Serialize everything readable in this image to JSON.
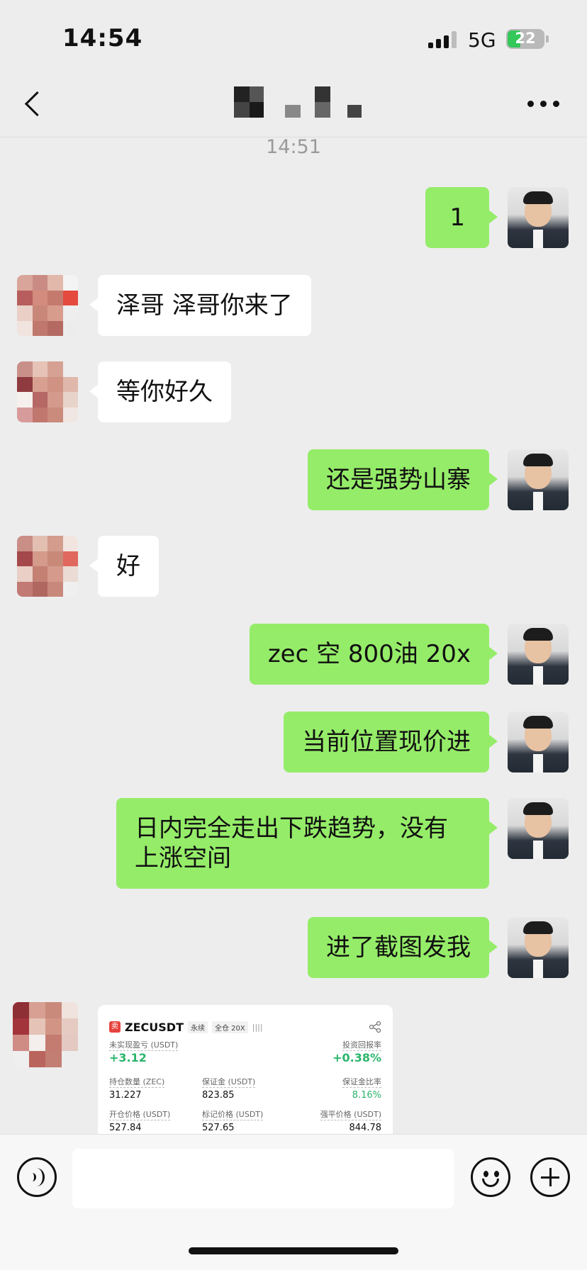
{
  "status_bar": {
    "time": "14:54",
    "network": "5G",
    "battery": "22"
  },
  "header": {
    "title": "",
    "back_icon": "chevron-left-icon",
    "more_icon": "more-dots-icon"
  },
  "timestamp": "14:51",
  "messages": [
    {
      "from": "me",
      "text": "1"
    },
    {
      "from": "them",
      "text": "泽哥 泽哥你来了"
    },
    {
      "from": "them",
      "text": "等你好久"
    },
    {
      "from": "me",
      "text": "还是强势山寨"
    },
    {
      "from": "them",
      "text": "好"
    },
    {
      "from": "me",
      "text": "zec 空 800油 20x"
    },
    {
      "from": "me",
      "text": "当前位置现价进"
    },
    {
      "from": "me",
      "text": "日内完全走出下跌趋势，没有上涨空间"
    },
    {
      "from": "me",
      "text": "进了截图发我"
    }
  ],
  "trade_card": {
    "side": "卖",
    "symbol": "ZECUSDT",
    "contract": "永续",
    "margin_mode": "全仓 20X",
    "unrealized_pnl_label": "未实现盈亏 (USDT)",
    "unrealized_pnl": "+3.12",
    "roi_label": "投资回报率",
    "roi": "+0.38%",
    "position_label": "持仓数量 (ZEC)",
    "position": "31.227",
    "margin_label": "保证金 (USDT)",
    "margin": "823.85",
    "margin_ratio_label": "保证金比率",
    "margin_ratio": "8.16%",
    "entry_label": "开仓价格 (USDT)",
    "entry": "527.84",
    "mark_label": "标记价格 (USDT)",
    "mark": "527.65",
    "liq_label": "强平价格 (USDT)",
    "liq": "844.78"
  },
  "colors": {
    "my_bubble": "#95ec69",
    "their_bubble": "#ffffff",
    "background": "#ededed",
    "profit_green": "#2bb56b"
  },
  "input_bar": {
    "voice_icon": "voice-icon",
    "emoji_icon": "emoji-icon",
    "plus_icon": "plus-icon"
  }
}
